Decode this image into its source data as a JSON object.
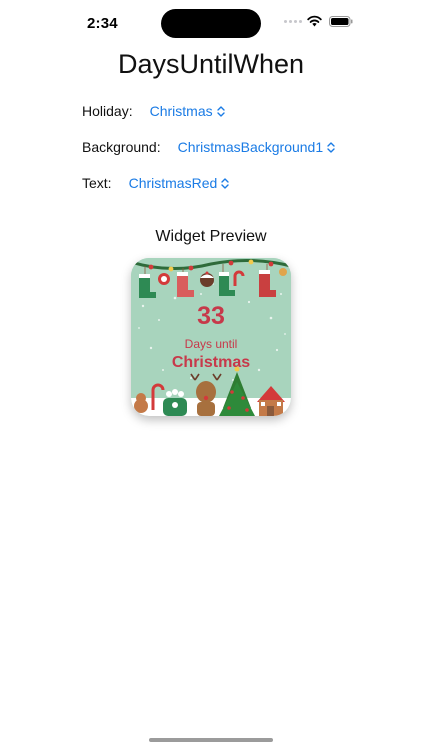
{
  "status_bar": {
    "time": "2:34",
    "icons": [
      "cellular-icon",
      "wifi-icon",
      "battery-icon"
    ]
  },
  "app": {
    "title": "DaysUntilWhen"
  },
  "settings": [
    {
      "label": "Holiday:",
      "value": "Christmas"
    },
    {
      "label": "Background:",
      "value": "ChristmasBackground1"
    },
    {
      "label": "Text:",
      "value": "ChristmasRed"
    }
  ],
  "preview": {
    "title": "Widget Preview",
    "widget": {
      "number": "33",
      "caption": "Days until",
      "holiday": "Christmas"
    }
  },
  "colors": {
    "accent": "#1a7be5",
    "widget_background": "#a8d4bd",
    "widget_text": "#c7394a"
  }
}
